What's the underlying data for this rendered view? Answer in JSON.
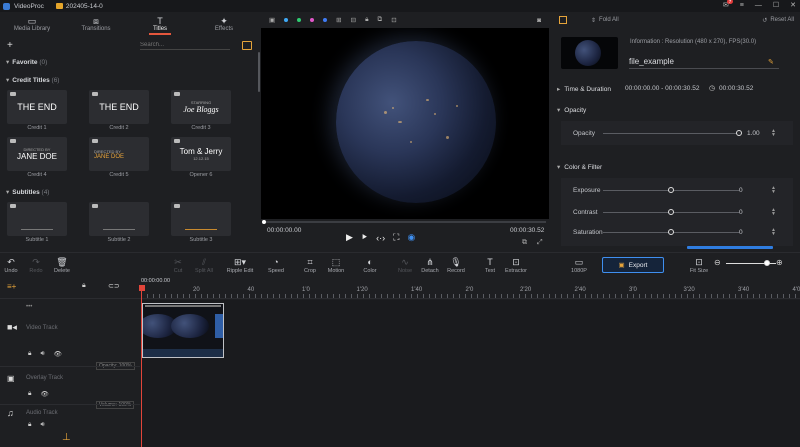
{
  "titlebar": {
    "app_name": "VideoProc",
    "project_name": "202405-14-0",
    "notification_count": "7"
  },
  "library": {
    "tabs": [
      {
        "label": "Media Library"
      },
      {
        "label": "Transitions"
      },
      {
        "label": "Titles"
      },
      {
        "label": "Effects"
      }
    ],
    "search_placeholder": "Search...",
    "favorite": {
      "label": "Favorite",
      "count": "(0)"
    },
    "credit_titles": {
      "label": "Credit Titles",
      "count": "(6)",
      "items": [
        {
          "label": "Credit 1",
          "text": "THE END"
        },
        {
          "label": "Credit 2",
          "text": "THE END"
        },
        {
          "label": "Credit 3",
          "text": "Joe Bloggs",
          "subtext": "STARRING"
        },
        {
          "label": "Credit 4",
          "text": "JANE DOE",
          "subtext": "DIRECTED BY"
        },
        {
          "label": "Credit 5",
          "text": "JANE DOE",
          "subtext": "DIRECTED BY"
        },
        {
          "label": "Opener 6",
          "text": "Tom & Jerry",
          "subtext": "12.12.15"
        }
      ]
    },
    "subtitles": {
      "label": "Subtitles",
      "count": "(4)",
      "items": [
        {
          "label": "Subtitle 1"
        },
        {
          "label": "Subtitle 2"
        },
        {
          "label": "Subtitle 3"
        }
      ]
    }
  },
  "preview": {
    "current_time": "00:00:00.00",
    "end_time": "00:00:30.52"
  },
  "properties": {
    "fold_all": "Fold All",
    "reset_all": "Reset All",
    "info": "Information : Resolution (480 x 270), FPS(30.0)",
    "filename": "file_example",
    "time_duration": {
      "label": "Time & Duration",
      "start": "00:00:00.00 - 00:00:30.52",
      "duration": "00:00:30.52"
    },
    "opacity": {
      "label": "Opacity",
      "row_label": "Opacity",
      "value": "1.00",
      "level": 1.0
    },
    "color_filter": {
      "label": "Color & Filter",
      "rows": [
        {
          "label": "Exposure",
          "value": "0",
          "level": 0.5
        },
        {
          "label": "Contrast",
          "value": "0",
          "level": 0.5
        },
        {
          "label": "Saturation",
          "value": "0",
          "level": 0.5
        }
      ]
    }
  },
  "toolbar": {
    "tools": [
      {
        "label": "Undo"
      },
      {
        "label": "Redo"
      },
      {
        "label": "Delete"
      },
      {
        "label": "Cut"
      },
      {
        "label": "Split All"
      },
      {
        "label": "Ripple Edit"
      },
      {
        "label": "Speed"
      },
      {
        "label": "Crop"
      },
      {
        "label": "Motion"
      },
      {
        "label": "Color"
      },
      {
        "label": "Noise"
      },
      {
        "label": "Detach"
      },
      {
        "label": "Record"
      },
      {
        "label": "Text"
      },
      {
        "label": "Extractor"
      },
      {
        "label": "1080P"
      }
    ],
    "export_label": "Export",
    "fit_size": "Fit Size"
  },
  "timeline": {
    "timecode": "00:00:00.00",
    "ruler_labels": [
      "20",
      "40",
      "1'0",
      "1'20",
      "1'40",
      "2'0",
      "2'20",
      "2'40",
      "3'0",
      "3'20",
      "3'40",
      "4'0"
    ],
    "tracks": [
      {
        "name": "Video Track",
        "value": "Opacity: 100%"
      },
      {
        "name": "Overlay Track",
        "value": "Volume: 100%"
      },
      {
        "name": "Audio Track",
        "value": ""
      }
    ]
  }
}
